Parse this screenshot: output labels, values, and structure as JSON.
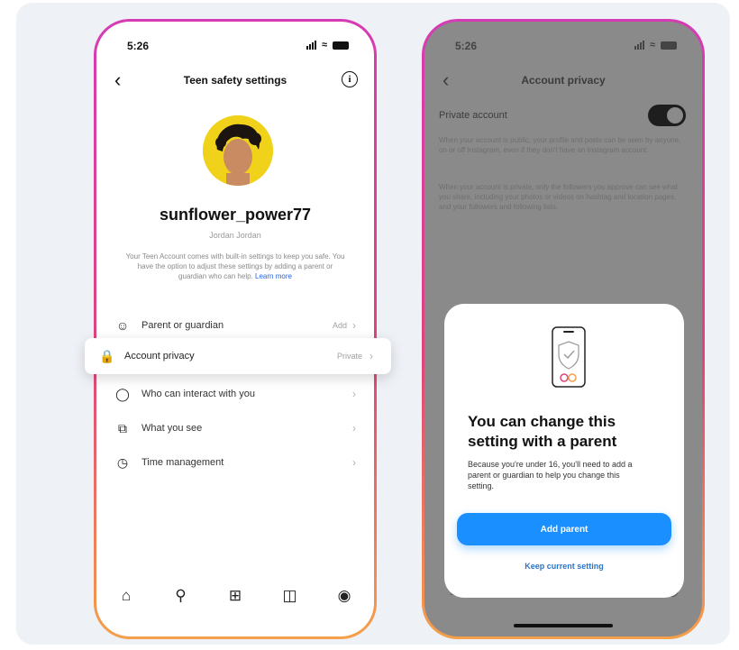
{
  "left_phone": {
    "status_time": "5:26",
    "header_title": "Teen safety settings",
    "back_icon": "chevron-left-icon",
    "info_icon": "info-icon",
    "username": "sunflower_power77",
    "subname": "Jordan Jordan",
    "blurb": "Your Teen Account comes with built-in settings to keep you safe. You have the option to adjust these settings by adding a parent or guardian who can help.",
    "blurb_link": "Learn more",
    "menu": [
      {
        "icon": "people-icon",
        "label": "Parent or guardian",
        "value": "Add"
      },
      {
        "icon": "lock-icon",
        "label": "Account privacy",
        "value": "Private"
      },
      {
        "icon": "chat-icon",
        "label": "Who can interact with you",
        "value": ""
      },
      {
        "icon": "eye-icon",
        "label": "What you see",
        "value": ""
      },
      {
        "icon": "clock-icon",
        "label": "Time management",
        "value": ""
      }
    ],
    "tabbar": [
      "home-icon",
      "search-icon",
      "add-icon",
      "reels-icon",
      "profile-icon"
    ]
  },
  "right_phone": {
    "status_time": "5:26",
    "header_title": "Account privacy",
    "toggle_label": "Private account",
    "dim_text_1": "When your account is public, your profile and posts can be seen by anyone, on or off Instagram, even if they don't have an Instagram account.",
    "dim_text_2": "When your account is private, only the followers you approve can see what you share, including your photos or videos on hashtag and location pages, and your followers and following lists.",
    "sheet": {
      "title": "You can change this setting with a parent",
      "body": "Because you're under 16, you'll need to add a parent or guardian to help you change this setting.",
      "primary_button": "Add parent",
      "secondary_link": "Keep current setting"
    }
  },
  "colors": {
    "accent_blue": "#1a8fff",
    "frame_gradient_top": "#d63bb5",
    "frame_gradient_bottom": "#f5a04a"
  }
}
